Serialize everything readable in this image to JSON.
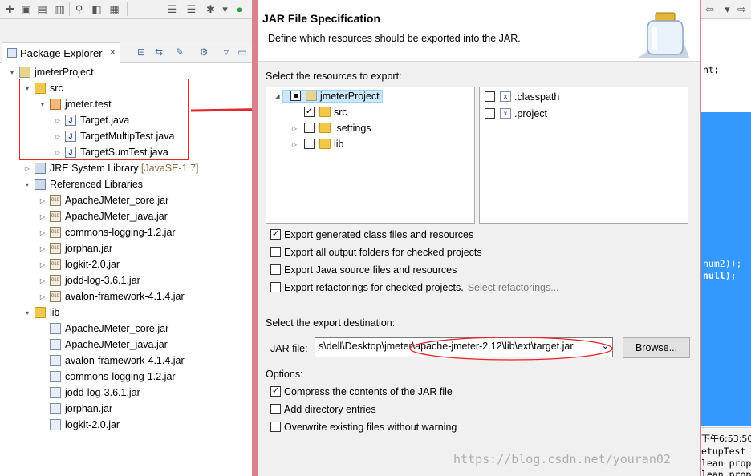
{
  "package_explorer": {
    "tab_label": "Package Explorer",
    "tree": [
      {
        "label": "jmeterProject",
        "icon": "project-icon",
        "expanded": true
      },
      {
        "label": "src",
        "icon": "source-folder-icon",
        "expanded": true
      },
      {
        "label": "jmeter.test",
        "icon": "package-icon",
        "expanded": true
      },
      {
        "label": "Target.java",
        "icon": "java-file-icon"
      },
      {
        "label": "TargetMultipTest.java",
        "icon": "java-file-icon"
      },
      {
        "label": "TargetSumTest.java",
        "icon": "java-file-icon"
      },
      {
        "label": "JRE System Library",
        "suffix": "[JavaSE-1.7]",
        "icon": "library-icon"
      },
      {
        "label": "Referenced Libraries",
        "icon": "library-icon",
        "expanded": true
      },
      {
        "label": "ApacheJMeter_core.jar",
        "icon": "jar-icon"
      },
      {
        "label": "ApacheJMeter_java.jar",
        "icon": "jar-icon"
      },
      {
        "label": "commons-logging-1.2.jar",
        "icon": "jar-icon"
      },
      {
        "label": "jorphan.jar",
        "icon": "jar-icon"
      },
      {
        "label": "logkit-2.0.jar",
        "icon": "jar-icon"
      },
      {
        "label": "jodd-log-3.6.1.jar",
        "icon": "jar-icon"
      },
      {
        "label": "avalon-framework-4.1.4.jar",
        "icon": "jar-icon"
      },
      {
        "label": "lib",
        "icon": "folder-icon",
        "expanded": true
      },
      {
        "label": "ApacheJMeter_core.jar",
        "icon": "jar-file-icon"
      },
      {
        "label": "ApacheJMeter_java.jar",
        "icon": "jar-file-icon"
      },
      {
        "label": "avalon-framework-4.1.4.jar",
        "icon": "jar-file-icon"
      },
      {
        "label": "commons-logging-1.2.jar",
        "icon": "jar-file-icon"
      },
      {
        "label": "jodd-log-3.6.1.jar",
        "icon": "jar-file-icon"
      },
      {
        "label": "jorphan.jar",
        "icon": "jar-file-icon"
      },
      {
        "label": "logkit-2.0.jar",
        "icon": "jar-file-icon"
      }
    ]
  },
  "dialog": {
    "title": "JAR File Specification",
    "description": "Define which resources should be exported into the JAR.",
    "resources_label": "Select the resources to export:",
    "resource_tree": [
      {
        "label": "jmeterProject",
        "checked": "partial",
        "expanded": true,
        "selected": true
      },
      {
        "label": "src",
        "checked": "checked"
      },
      {
        "label": ".settings",
        "checked": "unchecked"
      },
      {
        "label": "lib",
        "checked": "unchecked"
      }
    ],
    "files": [
      {
        "label": ".classpath",
        "checked": false
      },
      {
        "label": ".project",
        "checked": false
      }
    ],
    "export_options": [
      {
        "label": "Export generated class files and resources",
        "checked": true
      },
      {
        "label": "Export all output folders for checked projects",
        "checked": false
      },
      {
        "label": "Export Java source files and resources",
        "checked": false
      },
      {
        "label": "Export refactorings for checked projects.",
        "checked": false,
        "link": "Select refactorings..."
      }
    ],
    "destination_label": "Select the export destination:",
    "jar_file_label": "JAR file:",
    "jar_file_value": "s\\dell\\Desktop\\jmeter\\apache-jmeter-2.12\\lib\\ext\\target.jar",
    "browse_label": "Browse...",
    "options_label": "Options:",
    "options": [
      {
        "label": "Compress the contents of the JAR file",
        "checked": true
      },
      {
        "label": "Add directory entries",
        "checked": false
      },
      {
        "label": "Overwrite existing files without warning",
        "checked": false
      }
    ]
  },
  "editor_fragments": {
    "line1": "nt;",
    "line2": "num2));",
    "line3": "null);",
    "console_time": "下午6:53:50",
    "console_line1": "etupTest",
    "console_line2": "lean prop",
    "console_line3": "lean prop"
  },
  "watermark": "https://blog.csdn.net/youran02",
  "colors": {
    "annotation_red": "#e8232a",
    "dialog_frame": "#d9828d",
    "editor_selection": "#3399ff",
    "tree_selection": "#cce8ff"
  }
}
